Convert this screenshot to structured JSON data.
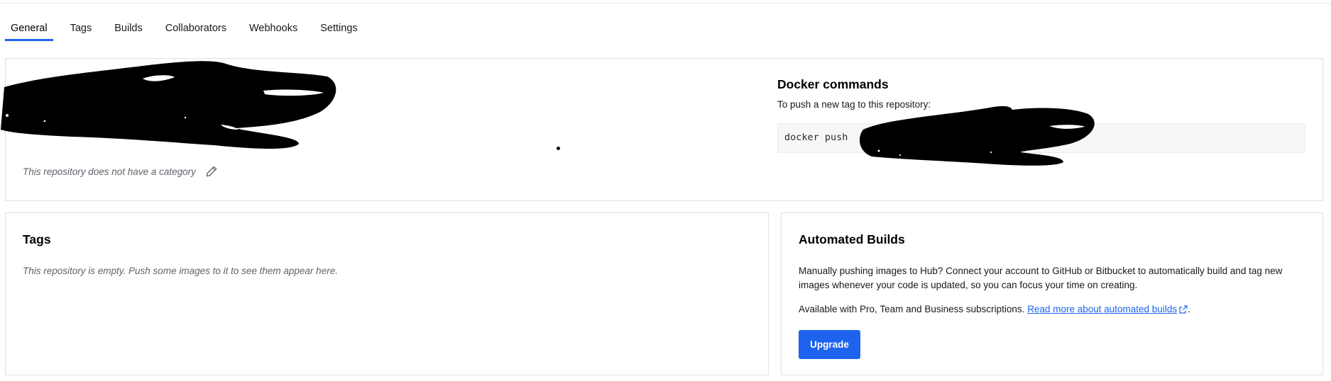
{
  "tabs": [
    {
      "label": "General",
      "active": true
    },
    {
      "label": "Tags"
    },
    {
      "label": "Builds"
    },
    {
      "label": "Collaborators"
    },
    {
      "label": "Webhooks"
    },
    {
      "label": "Settings"
    }
  ],
  "overview": {
    "category_text": "This repository does not have a category",
    "edit_icon": "pencil-icon"
  },
  "docker_commands": {
    "title": "Docker commands",
    "subtitle": "To push a new tag to this repository:",
    "command_prefix": "docker push"
  },
  "tags_panel": {
    "title": "Tags",
    "empty_text": "This repository is empty. Push some images to it to see them appear here."
  },
  "builds_panel": {
    "title": "Automated Builds",
    "description": "Manually pushing images to Hub? Connect your account to GitHub or Bitbucket to automatically build and tag new images whenever your code is updated, so you can focus your time on creating.",
    "availability_text": "Available with Pro, Team and Business subscriptions.",
    "link_text": "Read more about automated builds",
    "link_icon": "external-link-icon",
    "trailing": ".",
    "button_label": "Upgrade"
  },
  "colors": {
    "accent": "#1d63ed",
    "muted_text": "#5f636b",
    "border": "#dfe1e5"
  }
}
